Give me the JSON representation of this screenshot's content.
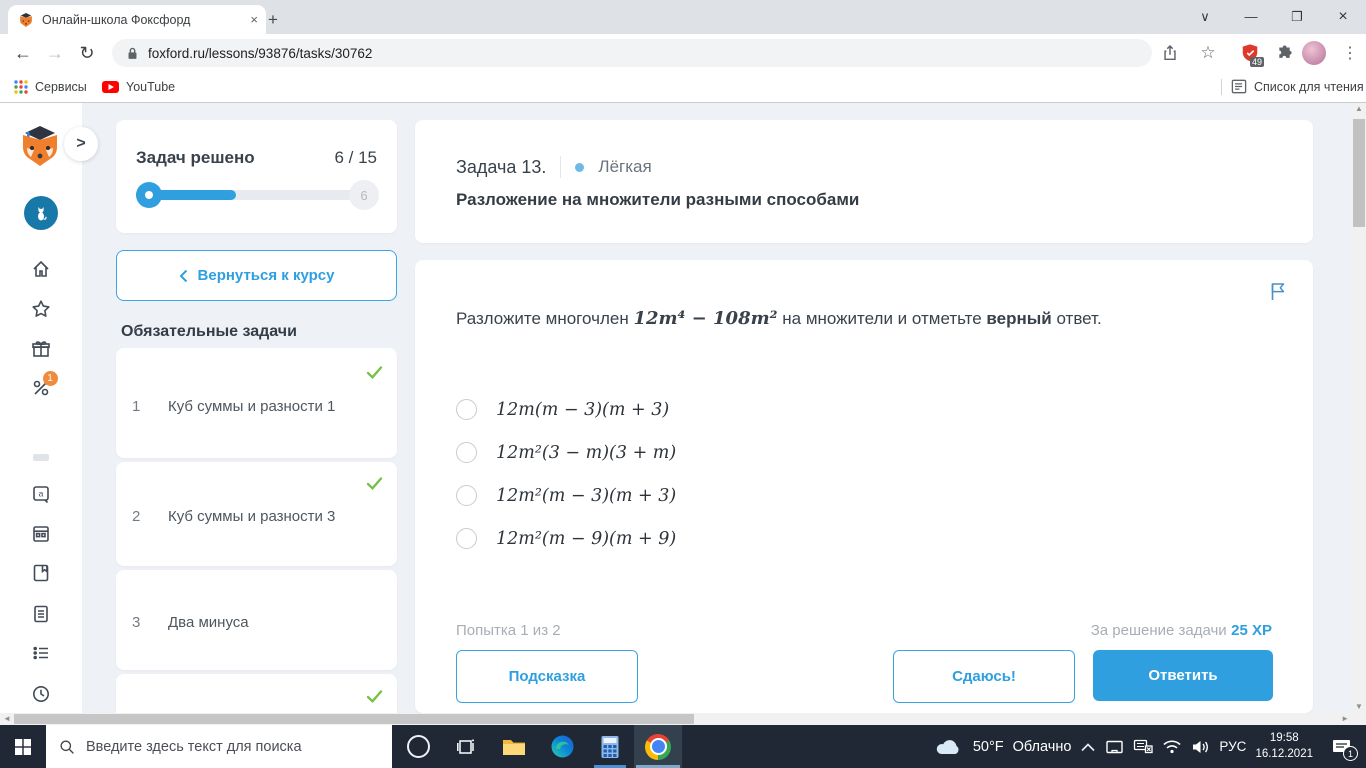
{
  "browser": {
    "tab_title": "Онлайн-школа Фоксфорд",
    "url": "foxford.ru/lessons/93876/tasks/30762",
    "ext_badge": "49",
    "bookmarks": {
      "services": "Сервисы",
      "youtube": "YouTube"
    },
    "reading_list": "Список для чтения"
  },
  "glyphs": {
    "back": "←",
    "forward": "→",
    "reload": "↻",
    "menu_dots": "⋮",
    "tab_close": "×",
    "new_tab": "+",
    "win_chevron": "∨",
    "win_min": "—",
    "win_max": "❐",
    "win_close": "×",
    "rail_expand": ">",
    "return_chevron": "<",
    "vscroll_up": "▲",
    "vscroll_down": "▼",
    "hscroll_left": "◄",
    "hscroll_right": "►"
  },
  "sidebar": {
    "promo_badge": "1"
  },
  "progress": {
    "title": "Задач решено",
    "value": "6 / 15",
    "end_badge": "6"
  },
  "course_button": {
    "label": "Вернуться к курсу"
  },
  "tasks": {
    "heading": "Обязательные задачи",
    "items": [
      {
        "num": "1",
        "title": "Куб суммы и разности 1"
      },
      {
        "num": "2",
        "title": "Куб суммы и разности 3"
      },
      {
        "num": "3",
        "title": "Два минуса"
      },
      {
        "num": "",
        "title": ""
      }
    ]
  },
  "task": {
    "header": {
      "number": "Задача 13.",
      "difficulty": "Лёгкая",
      "title": "Разложение на множители разными способами"
    },
    "question": {
      "before": "Разложите многочлен ",
      "math": "12m⁴ − 108m²",
      "middle": " на множители и отметьте ",
      "bold": "верный",
      "after": " ответ."
    },
    "options": [
      "12m(m − 3)(m + 3)",
      "12m²(3 − m)(3 + m)",
      "12m²(m − 3)(m + 3)",
      "12m²(m − 9)(m + 9)"
    ],
    "footer": {
      "attempt": "Попытка 1 из 2",
      "reward_label": "За решение задачи",
      "reward_value": "25 XP"
    },
    "buttons": {
      "hint": "Подсказка",
      "give_up": "Сдаюсь!",
      "answer": "Ответить"
    }
  },
  "taskbar": {
    "search_placeholder": "Введите здесь текст для поиска",
    "weather": {
      "temp": "50°F",
      "desc": "Облачно"
    },
    "lang": "РУС",
    "clock": {
      "time": "19:58",
      "date": "16.12.2021"
    },
    "notification_badge": "1"
  },
  "colors": {
    "accent_blue": "#2f9fe0",
    "success_green": "#76c043",
    "difficulty_dot": "#6fb9e8",
    "promo_orange": "#f08a3c",
    "adblock_red": "#e0382c",
    "taskbar_bg": "#1f2834"
  }
}
